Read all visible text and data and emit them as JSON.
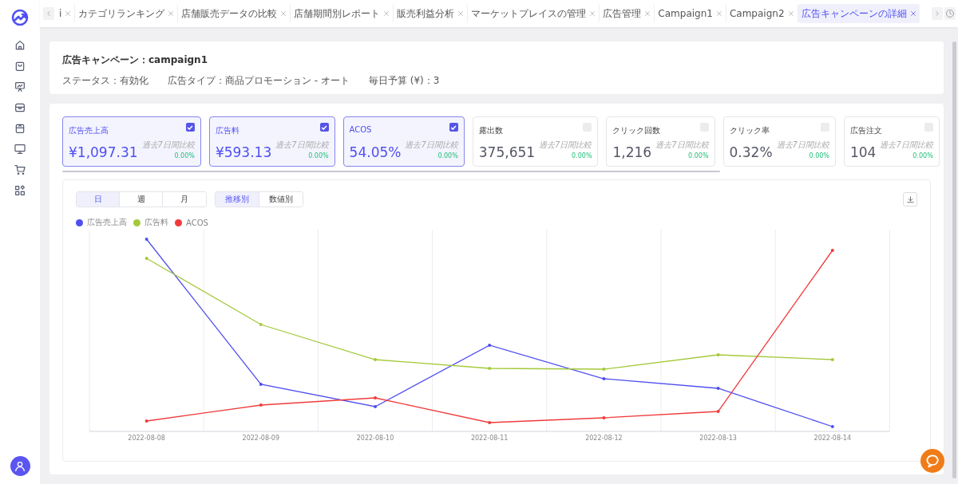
{
  "tabs": [
    {
      "label": "i",
      "selected": false
    },
    {
      "label": "カテゴリランキング",
      "selected": false
    },
    {
      "label": "店舗販売データの比較",
      "selected": false
    },
    {
      "label": "店舗期間別レポート",
      "selected": false
    },
    {
      "label": "販売利益分析",
      "selected": false
    },
    {
      "label": "マーケットプレイスの管理",
      "selected": false
    },
    {
      "label": "広告管理",
      "selected": false
    },
    {
      "label": "Campaign1",
      "selected": false
    },
    {
      "label": "Campaign2",
      "selected": false
    },
    {
      "label": "広告キャンペーンの詳細",
      "selected": true
    }
  ],
  "campaign": {
    "title": "広告キャンペーン：campaign1",
    "fields": [
      "ステータス：有効化",
      "広告タイプ：商品プロモーション - オート",
      "毎日予算 (¥)：3"
    ]
  },
  "metrics": [
    {
      "label": "広告売上高",
      "value": "¥1,097.31",
      "compare_label": "過去7日間比較",
      "change": "0.00%",
      "checked": true
    },
    {
      "label": "広告料",
      "value": "¥593.13",
      "compare_label": "過去7日間比較",
      "change": "0.00%",
      "checked": true
    },
    {
      "label": "ACOS",
      "value": "54.05%",
      "compare_label": "過去7日間比較",
      "change": "0.00%",
      "checked": true
    },
    {
      "label": "露出数",
      "value": "375,651",
      "compare_label": "過去7日間比較",
      "change": "0.00%",
      "checked": false
    },
    {
      "label": "クリック回数",
      "value": "1,216",
      "compare_label": "過去7日間比較",
      "change": "0.00%",
      "checked": false
    },
    {
      "label": "クリック率",
      "value": "0.32%",
      "compare_label": "過去7日間比較",
      "change": "0.00%",
      "checked": false
    },
    {
      "label": "広告注文",
      "value": "104",
      "compare_label": "過去7日間比較",
      "change": "0.00%",
      "checked": false
    }
  ],
  "chart": {
    "period_buttons": [
      {
        "label": "日",
        "selected": true
      },
      {
        "label": "週",
        "selected": false
      },
      {
        "label": "月",
        "selected": false
      }
    ],
    "view_buttons": [
      {
        "label": "推移別",
        "selected": true
      },
      {
        "label": "数値別",
        "selected": false
      }
    ],
    "legend": [
      {
        "label": "広告売上高",
        "color": "#4f4ff0"
      },
      {
        "label": "広告料",
        "color": "#a3c93a"
      },
      {
        "label": "ACOS",
        "color": "#f03a3a"
      }
    ],
    "x_labels": [
      "2022-08-08",
      "2022-08-09",
      "2022-08-10",
      "2022-08-11",
      "2022-08-12",
      "2022-08-13",
      "2022-08-14"
    ]
  }
}
